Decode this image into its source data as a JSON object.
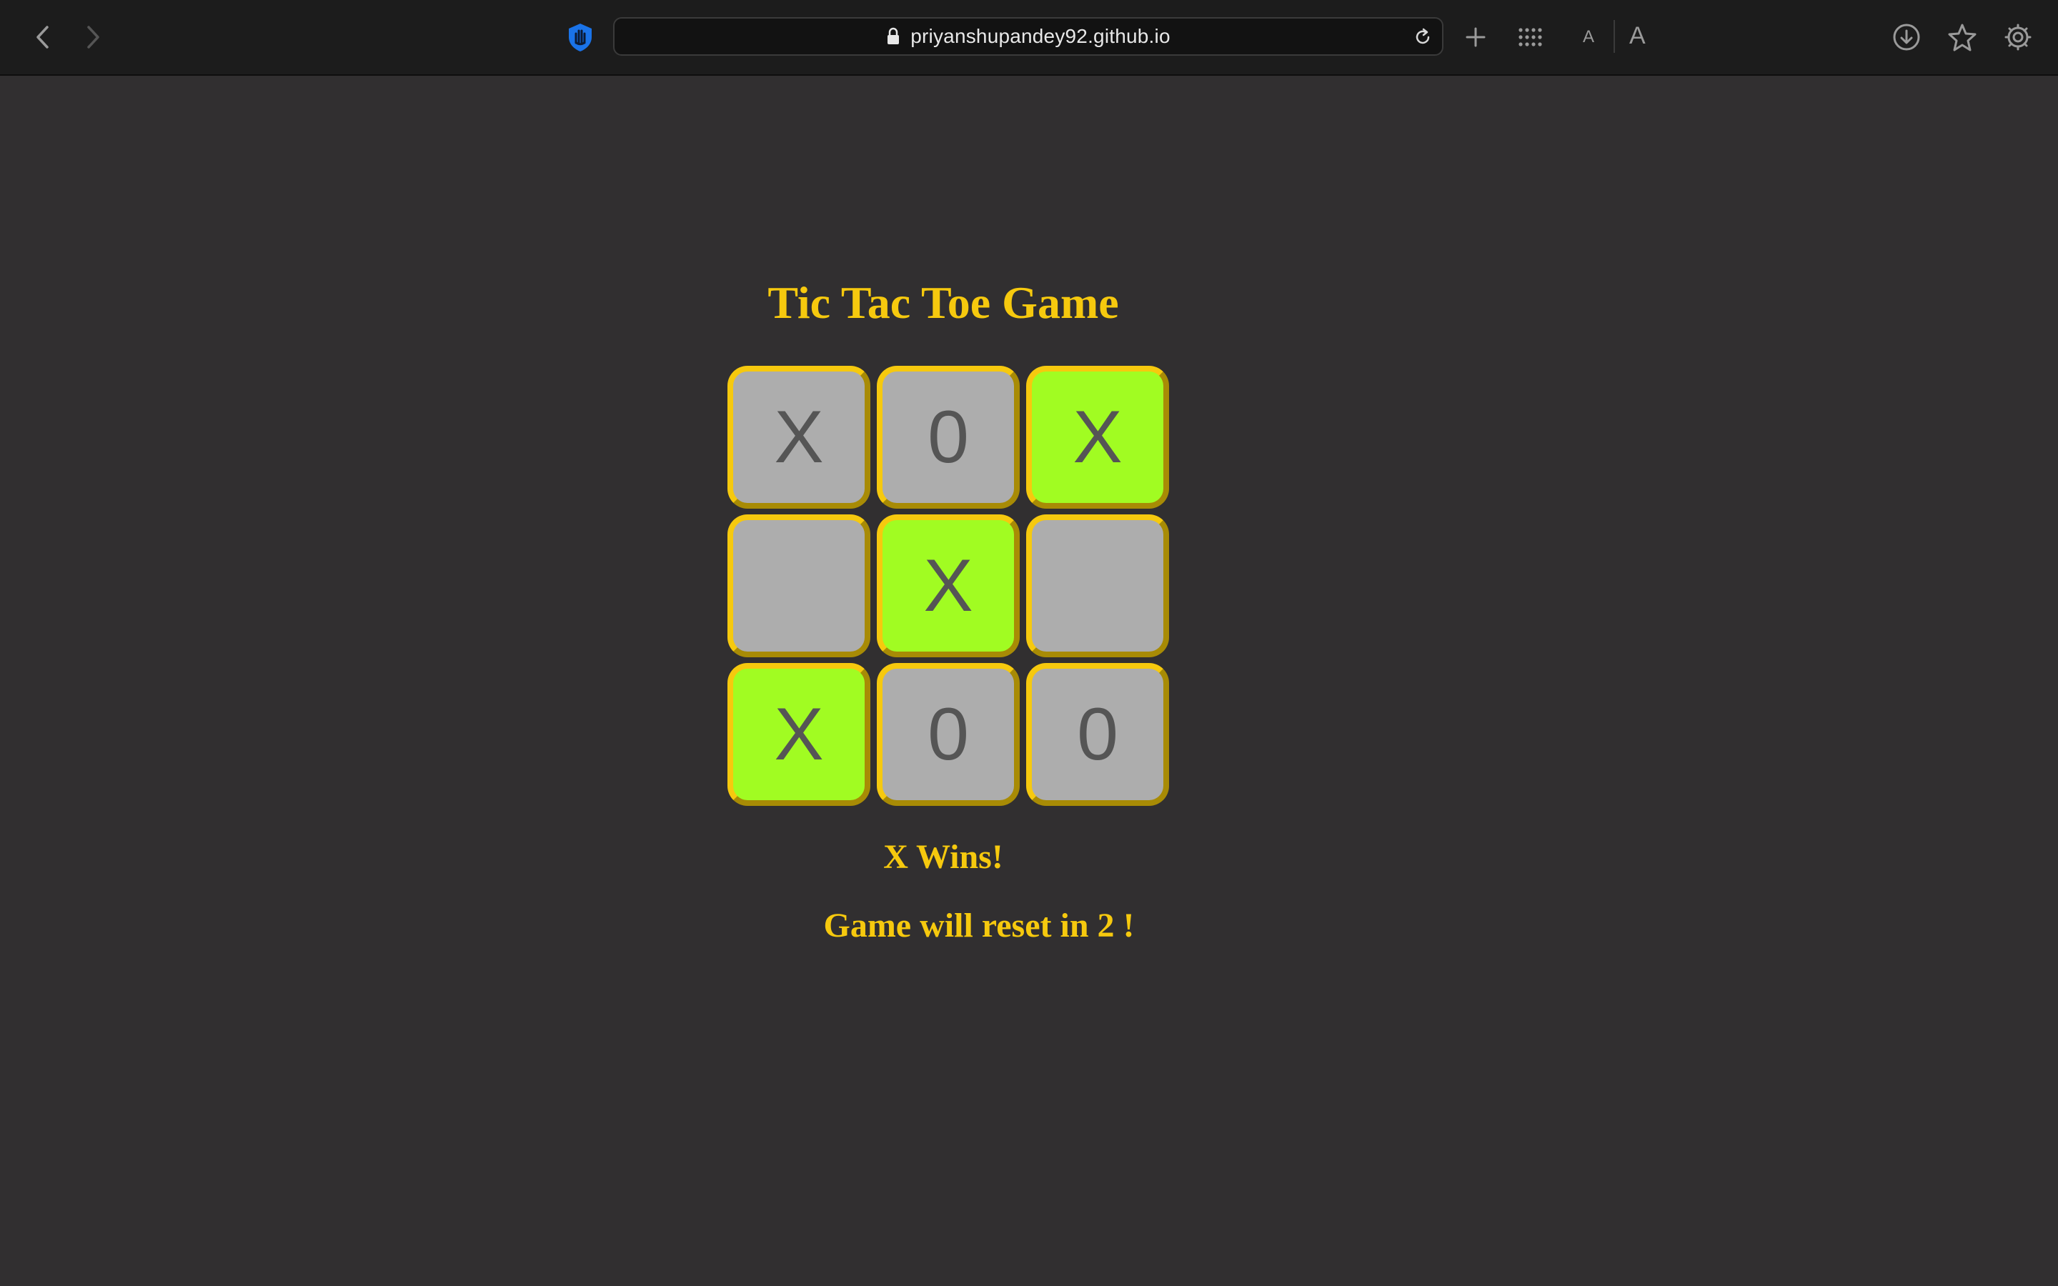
{
  "browser": {
    "url": "priyanshupandey92.github.io",
    "icons": {
      "back": "chevron-left-icon",
      "forward": "chevron-right-icon",
      "extension": "hand-shield-icon",
      "lock": "lock-icon",
      "reload": "reload-icon",
      "new_tab": "plus-icon",
      "tab_overview": "grid-icon",
      "download": "download-icon",
      "bookmark": "star-icon",
      "settings": "gear-icon"
    },
    "font_small_label": "A",
    "font_large_label": "A"
  },
  "game": {
    "title": "Tic Tac Toe Game",
    "board": [
      {
        "value": "X",
        "winning": false
      },
      {
        "value": "0",
        "winning": false
      },
      {
        "value": "X",
        "winning": true
      },
      {
        "value": "",
        "winning": false
      },
      {
        "value": "X",
        "winning": true
      },
      {
        "value": "",
        "winning": false
      },
      {
        "value": "X",
        "winning": true
      },
      {
        "value": "0",
        "winning": false
      },
      {
        "value": "0",
        "winning": false
      }
    ],
    "status": "X Wins!",
    "reset_message": "Game will reset in 2 !"
  },
  "colors": {
    "background": "#312f30",
    "accent": "#f6c90e",
    "cell": "#adadad",
    "winning_cell": "#a1fc22",
    "mark": "#555555"
  }
}
